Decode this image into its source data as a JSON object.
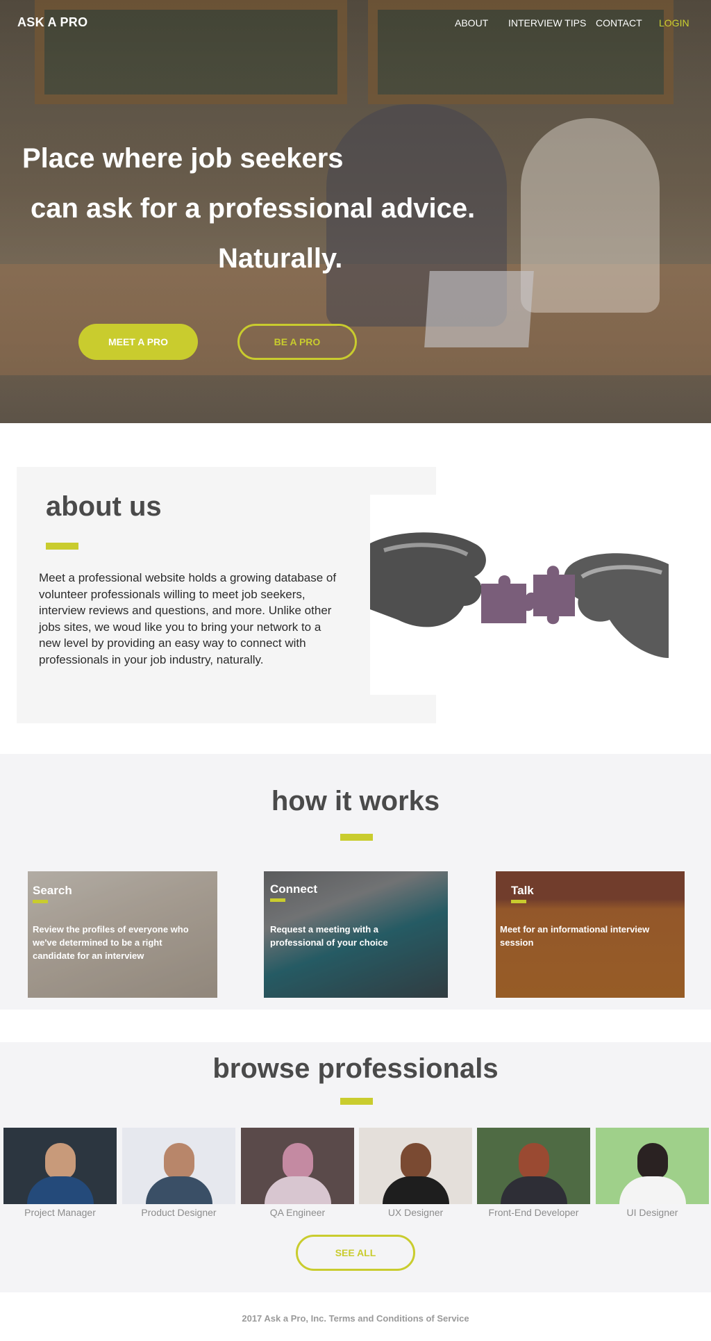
{
  "nav": {
    "logo": "ASK A PRO",
    "links": [
      "ABOUT",
      "INTERVIEW TIPS",
      "CONTACT"
    ],
    "login": "LOGIN"
  },
  "hero": {
    "line1": "Place where job seekers",
    "line2": "can ask for a professional advice.",
    "line3": "Naturally.",
    "meet_button": "MEET A PRO",
    "be_button": "BE A PRO"
  },
  "about": {
    "title": "about us",
    "text": "Meet a professional website holds a growing database of volunteer professionals willing to meet job seekers, interview reviews and questions, and more. Unlike other jobs sites, we woud like you to bring your network to a new level by providing an easy way to connect with professionals in your job industry, naturally."
  },
  "how": {
    "title": "how it works",
    "cards": [
      {
        "title": "Search",
        "desc": "Review the profiles of everyone who we've determined to be a right candidate for an interview"
      },
      {
        "title": "Connect",
        "desc": "Request a meeting with a professional of your choice"
      },
      {
        "title": "Talk",
        "desc": "Meet for an informational interview session"
      }
    ]
  },
  "browse": {
    "title": "browse professionals",
    "pros": [
      {
        "role": "Project Manager"
      },
      {
        "role": "Product Designer"
      },
      {
        "role": "QA Engineer"
      },
      {
        "role": "UX Designer"
      },
      {
        "role": "Front-End Developer"
      },
      {
        "role": "UI Designer"
      }
    ],
    "see_all": "SEE ALL"
  },
  "footer": {
    "text": "2017 Ask a Pro, Inc. Terms and Conditions of Service"
  },
  "colors": {
    "accent": "#c9cc2e",
    "heading": "#4a4a4a",
    "section_bg": "#f4f4f6"
  }
}
